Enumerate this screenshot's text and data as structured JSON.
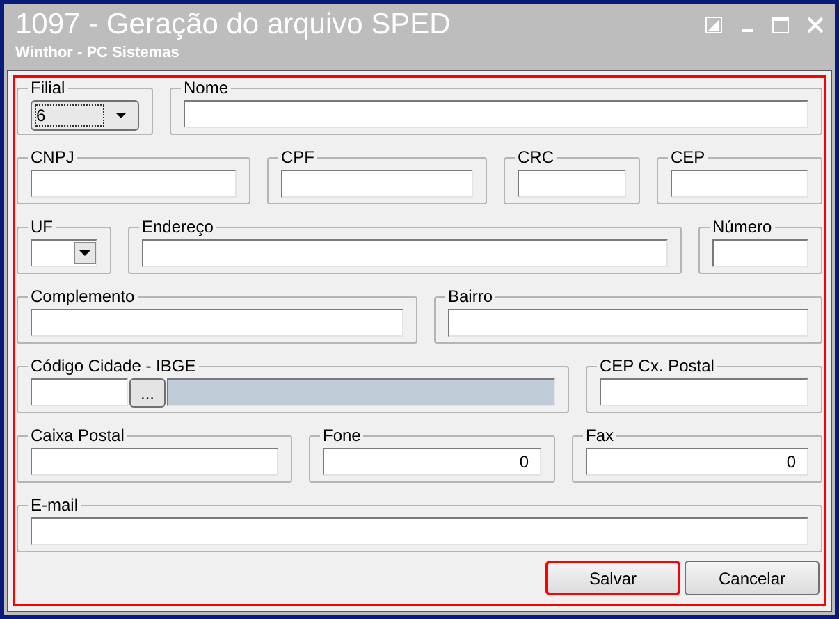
{
  "window": {
    "title": "1097 - Geração do arquivo SPED",
    "subtitle": "Winthor - PC Sistemas"
  },
  "form": {
    "highlighted": true,
    "fields": [
      {
        "label": "Filial",
        "kind": "combo",
        "value": "6",
        "focused": true
      },
      {
        "label": "Nome",
        "kind": "text"
      },
      {
        "label": "CNPJ",
        "kind": "text"
      },
      {
        "label": "CPF",
        "kind": "text"
      },
      {
        "label": "CRC",
        "kind": "text"
      },
      {
        "label": "CEP",
        "kind": "text"
      },
      {
        "label": "UF",
        "kind": "combo",
        "focused": false
      },
      {
        "label": "Endereço",
        "kind": "text"
      },
      {
        "label": "Número",
        "kind": "text"
      },
      {
        "label": "Complemento",
        "kind": "text"
      },
      {
        "label": "Bairro",
        "kind": "text"
      },
      {
        "label": "Código Cidade - IBGE",
        "kind": "lookup",
        "button_label": "..."
      },
      {
        "label": "CEP Cx. Postal",
        "kind": "text"
      },
      {
        "label": "Caixa Postal",
        "kind": "text"
      },
      {
        "label": "Fone",
        "kind": "number",
        "value": "0"
      },
      {
        "label": "Fax",
        "kind": "number",
        "value": "0"
      },
      {
        "label": "E-mail",
        "kind": "text"
      }
    ]
  },
  "buttons": [
    {
      "label": "Salvar",
      "highlighted": true
    },
    {
      "label": "Cancelar",
      "highlighted": false
    }
  ]
}
